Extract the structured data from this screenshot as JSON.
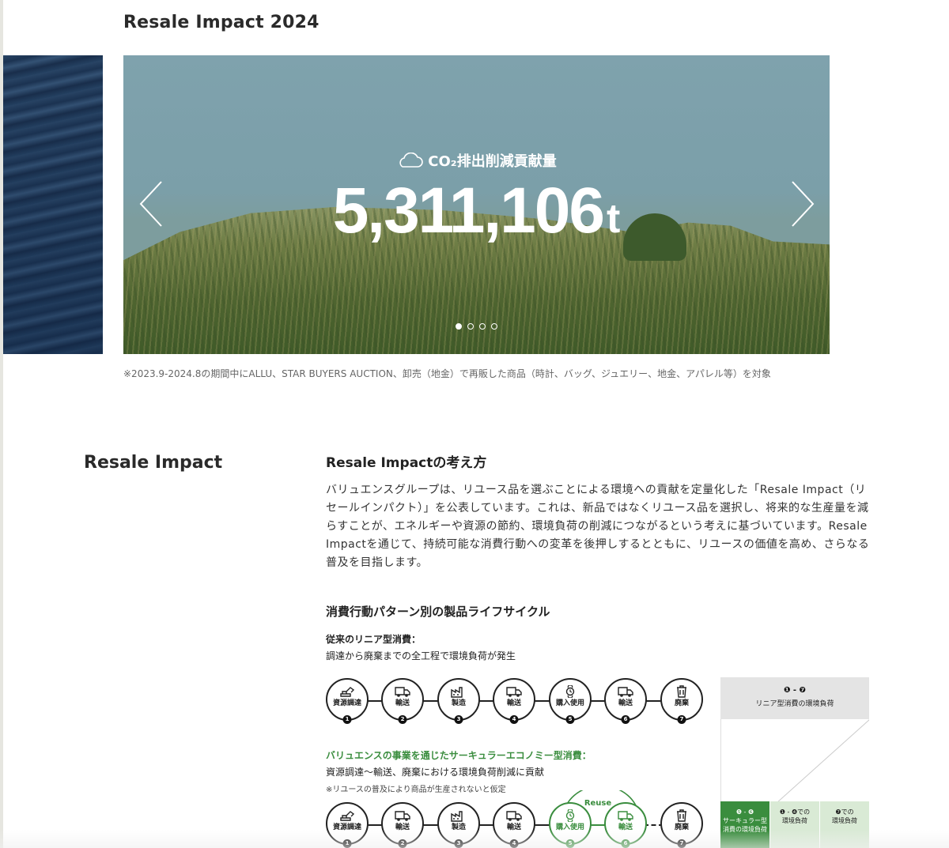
{
  "page": {
    "title": "Resale Impact 2024"
  },
  "carousel": {
    "label": "CO₂排出削減貢献量",
    "value": "5,311,106",
    "unit": "t",
    "slide_count": 4,
    "active_slide": 1,
    "footnote": "※2023.9-2024.8の期間中にALLU、STAR BUYERS AUCTION、卸売（地金）で再販した商品（時計、バッグ、ジュエリー、地金、アパレル等）を対象"
  },
  "section": {
    "title": "Resale Impact",
    "subtitle": "Resale Impactの考え方",
    "body": "バリュエンスグループは、リユース品を選ぶことによる環境への貢献を定量化した「Resale Impact（リセールインパクト）」を公表しています。これは、新品ではなくリユース品を選択し、将来的な生産量を減らすことが、エネルギーや資源の節約、環境負荷の削減につながるという考えに基づいています。Resale Impactを通じて、持続可能な消費行動への変革を後押しするとともに、リユースの価値を高め、さらなる普及を目指します。"
  },
  "lifecycle": {
    "heading": "消費行動パターン別の製品ライフサイクル",
    "linear": {
      "title": "従来のリニア型消費：",
      "desc": "調達から廃棄までの全工程で環境負荷が発生",
      "steps": [
        {
          "label": "資源調達",
          "num": "1",
          "icon": "excavator-icon"
        },
        {
          "label": "輸送",
          "num": "2",
          "icon": "truck-icon"
        },
        {
          "label": "製造",
          "num": "3",
          "icon": "factory-icon"
        },
        {
          "label": "輸送",
          "num": "4",
          "icon": "truck-icon"
        },
        {
          "label": "購入使用",
          "num": "5",
          "icon": "watch-icon"
        },
        {
          "label": "輸送",
          "num": "6",
          "icon": "truck-icon"
        },
        {
          "label": "廃棄",
          "num": "7",
          "icon": "trash-icon"
        }
      ]
    },
    "circular": {
      "title": "バリュエンスの事業を通じたサーキュラーエコノミー型消費：",
      "desc": "資源調達〜輸送、廃棄における環境負荷削減に貢献",
      "note": "※リユースの普及により商品が生産されないと仮定",
      "reuse_label": "Reuse",
      "steps": [
        {
          "label": "資源調達",
          "num": "1"
        },
        {
          "label": "輸送",
          "num": "2"
        },
        {
          "label": "製造",
          "num": "3"
        },
        {
          "label": "輸送",
          "num": "4"
        },
        {
          "label": "購入使用",
          "num": "5"
        },
        {
          "label": "輸送",
          "num": "6"
        },
        {
          "label": "廃棄",
          "num": "7"
        }
      ]
    }
  },
  "comparison": {
    "head_range": "❶ - ❼",
    "head_label": "リニア型消費の環境負荷",
    "foot": [
      {
        "range": "❺ - ❻",
        "label": "サーキュラー型 消費の環境負荷"
      },
      {
        "range": "❶ - ❹での",
        "label": "環境負荷"
      },
      {
        "range": "❼での",
        "label": "環境負荷"
      }
    ]
  },
  "colors": {
    "accent_green": "#3a8d3e",
    "text": "#222222",
    "muted": "#666666"
  }
}
